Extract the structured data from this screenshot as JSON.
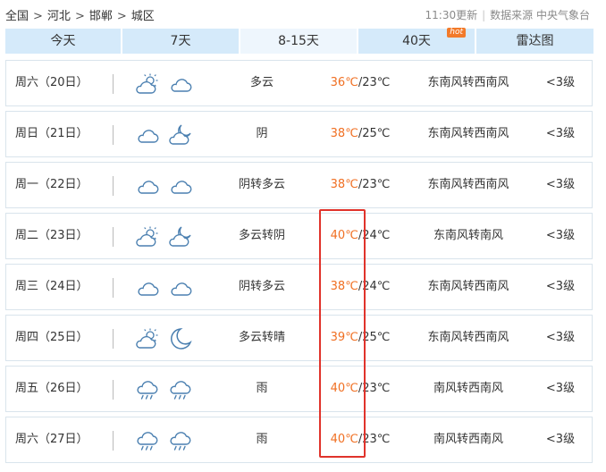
{
  "breadcrumb": [
    "全国",
    "河北",
    "邯郸",
    "城区"
  ],
  "meta": {
    "updated": "11:30更新",
    "source": "数据来源 中央气象台"
  },
  "tabs": [
    {
      "label": "今天"
    },
    {
      "label": "7天"
    },
    {
      "label": "8-15天",
      "active": true
    },
    {
      "label": "40天",
      "badge": "hot"
    },
    {
      "label": "雷达图"
    }
  ],
  "forecast": [
    {
      "day": "周六（20日）",
      "icons": [
        "sun-cloud-icon",
        "cloud-icon"
      ],
      "weather": "多云",
      "high": "36℃",
      "low": "/23℃",
      "wind": "东南风转西南风",
      "level": "<3级"
    },
    {
      "day": "周日（21日）",
      "icons": [
        "cloud-icon",
        "cloud-moon-icon"
      ],
      "weather": "阴",
      "high": "38℃",
      "low": "/25℃",
      "wind": "东南风转西南风",
      "level": "<3级"
    },
    {
      "day": "周一（22日）",
      "icons": [
        "cloud-icon",
        "cloud-icon"
      ],
      "weather": "阴转多云",
      "high": "38℃",
      "low": "/23℃",
      "wind": "东南风转西南风",
      "level": "<3级"
    },
    {
      "day": "周二（23日）",
      "icons": [
        "sun-cloud-icon",
        "cloud-moon-icon"
      ],
      "weather": "多云转阴",
      "high": "40℃",
      "low": "/24℃",
      "wind": "东南风转南风",
      "level": "<3级"
    },
    {
      "day": "周三（24日）",
      "icons": [
        "cloud-icon",
        "cloud-icon"
      ],
      "weather": "阴转多云",
      "high": "38℃",
      "low": "/24℃",
      "wind": "东南风转西南风",
      "level": "<3级"
    },
    {
      "day": "周四（25日）",
      "icons": [
        "sun-cloud-icon",
        "moon-icon"
      ],
      "weather": "多云转晴",
      "high": "39℃",
      "low": "/25℃",
      "wind": "东南风转西南风",
      "level": "<3级"
    },
    {
      "day": "周五（26日）",
      "icons": [
        "rain-icon",
        "rain-icon"
      ],
      "weather": "雨",
      "high": "40℃",
      "low": "/23℃",
      "wind": "南风转西南风",
      "level": "<3级"
    },
    {
      "day": "周六（27日）",
      "icons": [
        "rain-icon",
        "rain-icon"
      ],
      "weather": "雨",
      "high": "40℃",
      "low": "/23℃",
      "wind": "南风转西南风",
      "level": "<3级"
    }
  ],
  "colors": {
    "tab_bg": "#d5eafa",
    "high_temp": "#f06f22",
    "highlight_box": "#e0332b",
    "hot_badge": "#f27a2a"
  }
}
